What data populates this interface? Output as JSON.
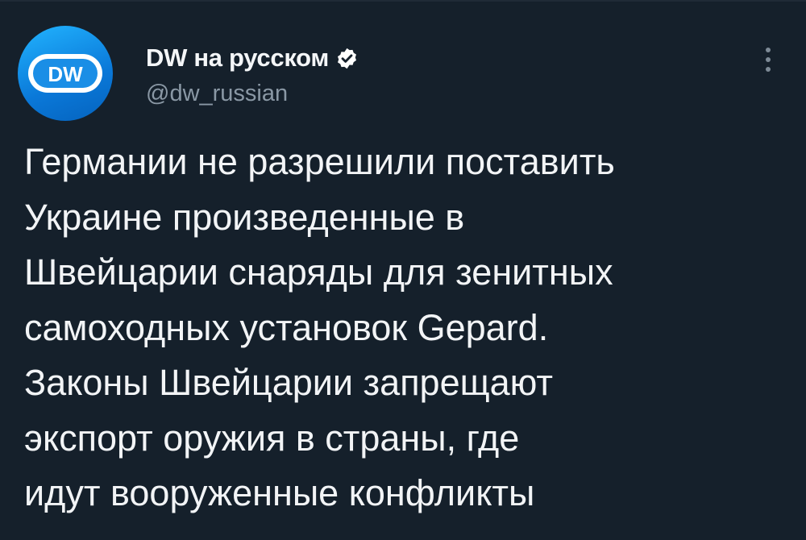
{
  "account": {
    "display_name": "DW на русском",
    "handle": "@dw_russian",
    "avatar_text": "DW",
    "verified": true,
    "avatar_icon": "dw-logo-icon",
    "verified_icon": "verified-badge-icon",
    "more_icon": "more-options-icon"
  },
  "tweet": {
    "lines": [
      "Германии не разрешили поставить",
      "Украине произведенные в",
      "Швейцарии снаряды для зенитных",
      "самоходных установок Gepard.",
      "Законы Швейцарии запрещают",
      "экспорт оружия в страны, где",
      "идут вооруженные конфликты"
    ]
  },
  "colors": {
    "background": "#15202b",
    "text_primary": "#f2f4f6",
    "text_secondary": "#8a98a5",
    "avatar_blue": "#0a78d8"
  }
}
